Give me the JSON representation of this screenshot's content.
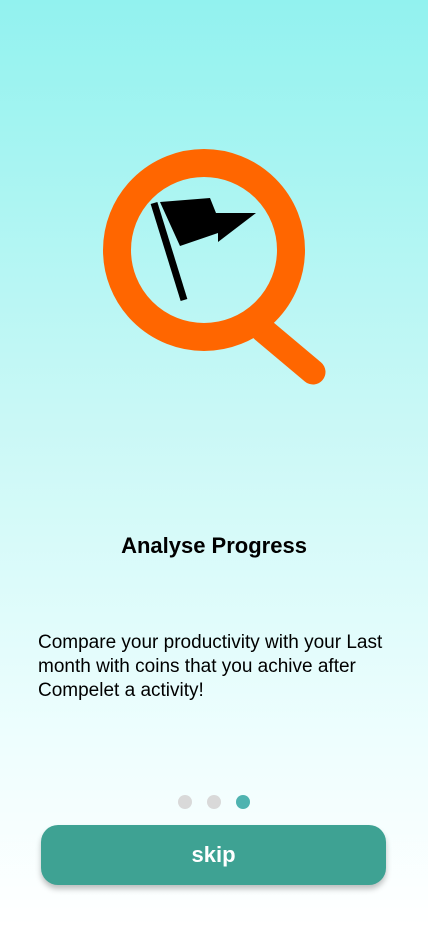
{
  "onboarding": {
    "illustration_icon": "magnifier-flag-icon",
    "title": "Analyse Progress",
    "description": "Compare your productivity with your Last month with coins that you achive after Compelet a activity!",
    "pager": {
      "total": 3,
      "active_index": 2
    },
    "skip_label": "skip"
  },
  "colors": {
    "accent": "#3ea293",
    "active_dot": "#4fb3b0",
    "inactive_dot": "#d9d9d9",
    "magnifier": "#ff6600",
    "background_top": "#92f2ef"
  }
}
